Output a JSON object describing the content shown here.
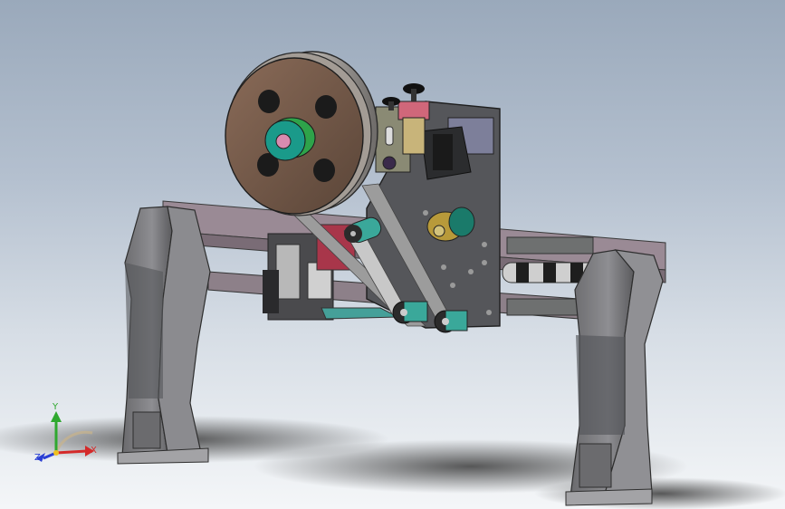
{
  "viewport": {
    "background_top": "#9aa9bb",
    "background_bottom": "#f4f6f8"
  },
  "triad": {
    "x_label": "X",
    "y_label": "Y",
    "z_label": "Z",
    "x_color": "#d42a2a",
    "y_color": "#2fa82f",
    "z_color": "#2a3fd4"
  },
  "model": {
    "frame_color": "#7a7a7e",
    "rail_color": "#8a7a85",
    "plate_color": "#55565a",
    "reel_color": "#6b5447",
    "hub_color": "#1a9a8a",
    "motor_color": "#2b2c2e"
  }
}
